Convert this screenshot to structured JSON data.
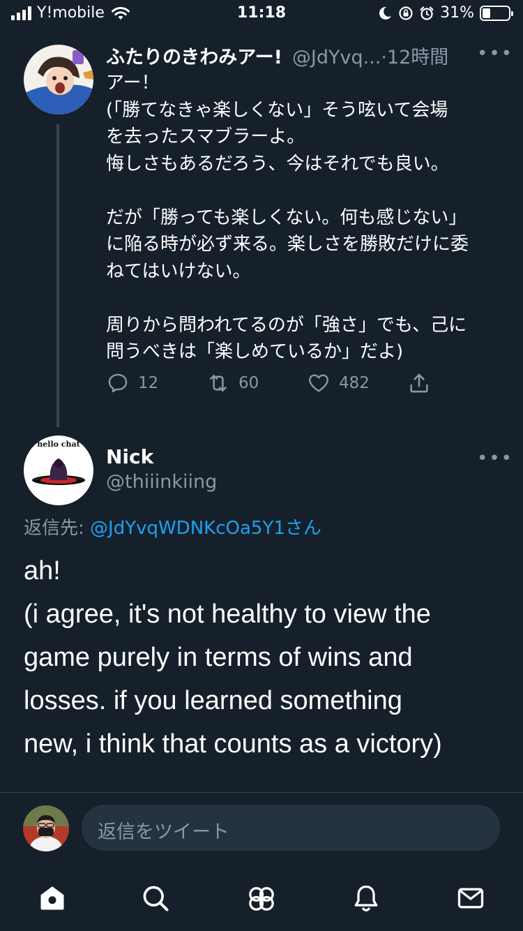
{
  "status_bar": {
    "carrier": "Y!mobile",
    "time": "11:18",
    "battery_percent": "31%",
    "battery_level": 0.31,
    "icons": [
      "signal-icon",
      "wifi-icon",
      "moon-icon",
      "rotation-lock-icon",
      "alarm-icon",
      "battery-icon"
    ]
  },
  "tweet1": {
    "display_name": "ふたりのきわみアー!",
    "handle": "@JdYvq...",
    "sep": "·",
    "time": "12時間",
    "more": "•••",
    "text": "アー！\n(「勝てなきゃ楽しくない」そう呟いて会場\nを去ったスマブラーよ。\n悔しさもあるだろう、今はそれでも良い。\n\nだが「勝っても楽しくない。何も感じない」\nに陥る時が必ず来る。楽しさを勝敗だけに委\nねてはいけない。\n\n周りから問われてるのが「強さ」でも、己に\n問うべきは「楽しめているか」だよ)",
    "reply_count": "12",
    "retweet_count": "60",
    "like_count": "482"
  },
  "tweet2": {
    "avatar_text": "hello chat",
    "display_name": "Nick",
    "handle": "@thiiinkiing",
    "more": "•••",
    "reply_to_label": "返信先: ",
    "reply_to_handle": "@JdYvqWDNKcOa5Y1さん",
    "text": "ah!\n(i agree, it's not healthy to view the\ngame purely in terms of wins and\nlosses. if you learned something\nnew, i think that counts as a victory)"
  },
  "composer": {
    "placeholder": "返信をツイート"
  },
  "tabbar": {
    "items": [
      "home-icon",
      "search-icon",
      "communities-icon",
      "notifications-icon",
      "messages-icon"
    ]
  },
  "colors": {
    "background": "#15202b",
    "secondary_text": "#8899a6",
    "link": "#1da1f2",
    "divider": "#38444d"
  }
}
